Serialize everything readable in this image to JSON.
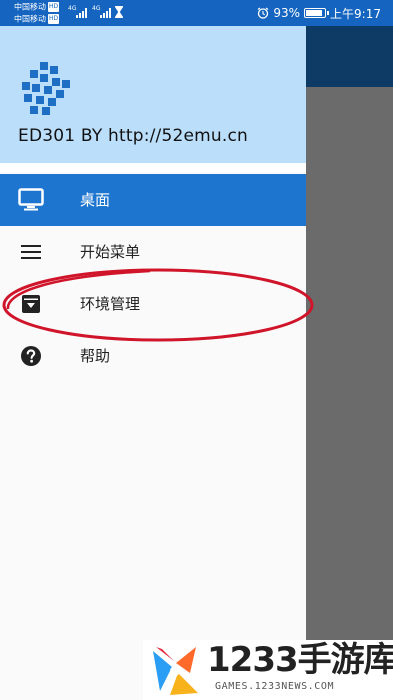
{
  "status_bar": {
    "carrier_1": "中国移动",
    "carrier_2": "中国移动",
    "hd_badge": "HD",
    "network_type": "4G",
    "battery_percent": "93%",
    "battery_level": 0.93,
    "time": "上午9:17",
    "icons": [
      "signal-icon",
      "hourglass-icon",
      "alarm-clock-icon",
      "battery-icon"
    ]
  },
  "drawer": {
    "app_title": "ED301 BY http://52emu.cn",
    "logo": "app-logo-cubes",
    "items": [
      {
        "label": "桌面",
        "icon": "monitor-icon",
        "active": true
      },
      {
        "label": "开始菜单",
        "icon": "hamburger-menu-icon",
        "active": false
      },
      {
        "label": "环境管理",
        "icon": "archive-box-icon",
        "active": false
      },
      {
        "label": "帮助",
        "icon": "help-circle-icon",
        "active": false
      }
    ]
  },
  "colors": {
    "status_bar": "#1565c0",
    "drawer_header": "#bbdefb",
    "active_item": "#1e75cf",
    "annotation": "#d0152a",
    "scrim": "#6b6b6b"
  },
  "watermark": {
    "brand": "1233手游库",
    "url": "GAMES.1233NEWS.COM"
  }
}
